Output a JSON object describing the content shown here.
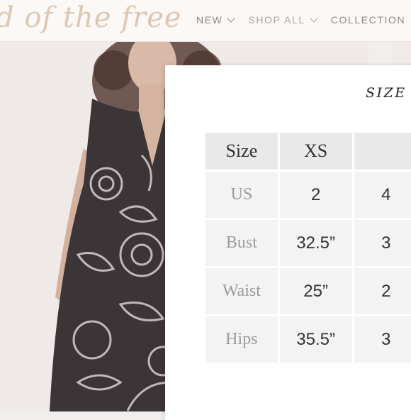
{
  "header": {
    "logo_text": "d of the free",
    "nav": [
      {
        "label": "NEW"
      },
      {
        "label": "SHOP ALL"
      },
      {
        "label": "COLLECTION"
      }
    ]
  },
  "colors": {
    "logo": "#ddc7b3",
    "header_bg": "#fbf8f6",
    "dress_dark": "#3b3537",
    "table_cell": "#f3f3f3"
  },
  "modal": {
    "title": "SIZE",
    "table": {
      "header": [
        "Size",
        "XS",
        ""
      ],
      "rows": [
        {
          "label": "US",
          "values": [
            "2",
            "4"
          ]
        },
        {
          "label": "Bust",
          "values": [
            "32.5”",
            "3"
          ]
        },
        {
          "label": "Waist",
          "values": [
            "25”",
            "2"
          ]
        },
        {
          "label": "Hips",
          "values": [
            "35.5”",
            "3"
          ]
        }
      ]
    }
  }
}
